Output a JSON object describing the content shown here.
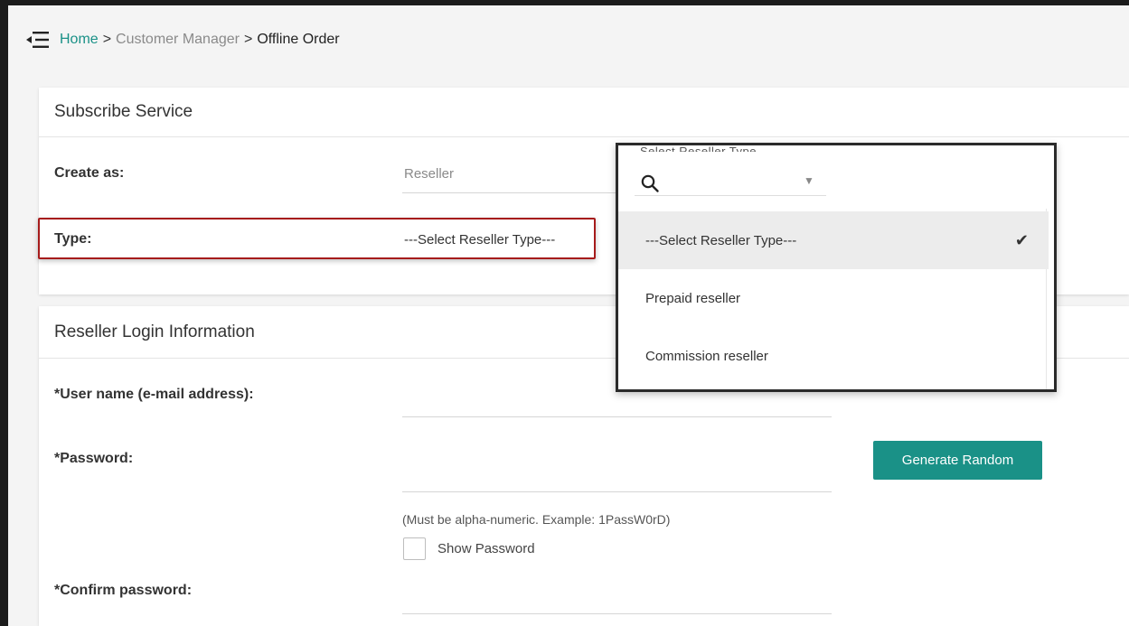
{
  "breadcrumb": {
    "home": "Home",
    "separator": ">",
    "customer_manager": "Customer Manager",
    "current": "Offline Order"
  },
  "subscribe": {
    "title": "Subscribe Service",
    "create_as_label": "Create as:",
    "create_as_value": "Reseller",
    "type_label": "Type:",
    "type_value": "---Select Reseller Type---"
  },
  "dropdown": {
    "header_label": "Select Reseller Type",
    "options": [
      {
        "label": "---Select Reseller Type---",
        "selected": true
      },
      {
        "label": "Prepaid reseller",
        "selected": false
      },
      {
        "label": "Commission reseller",
        "selected": false
      }
    ],
    "check_glyph": "✔"
  },
  "login": {
    "title": "Reseller Login Information",
    "username_label": "*User name (e-mail address):",
    "password_label": "*Password:",
    "generate_button": "Generate Random",
    "password_hint": "(Must be alpha-numeric. Example: 1PassW0rD)",
    "show_password": "Show Password",
    "confirm_label": "*Confirm password:"
  },
  "colors": {
    "accent": "#1a9187",
    "highlight": "#a61b1b"
  }
}
